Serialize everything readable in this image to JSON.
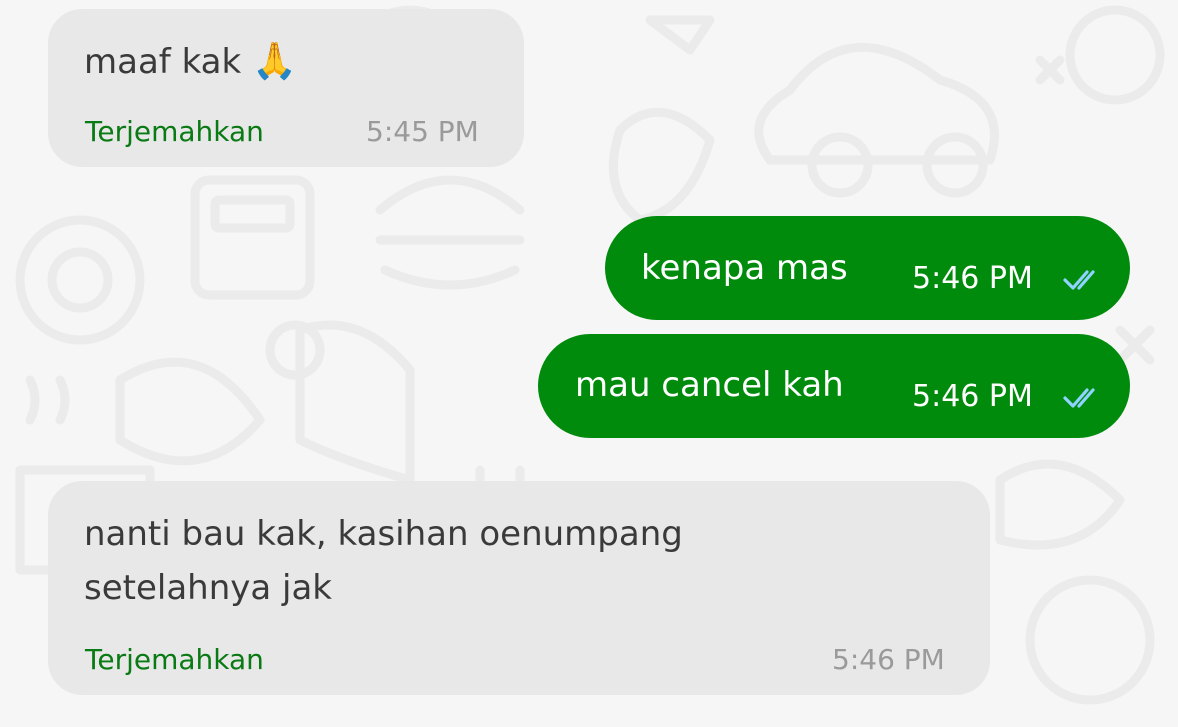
{
  "messages": [
    {
      "direction": "incoming",
      "text": "maaf kak",
      "emoji": "🙏",
      "emoji_name": "folded-hands",
      "translate_label": "Terjemahkan",
      "time": "5:45 PM"
    },
    {
      "direction": "outgoing",
      "text": "kenapa mas",
      "time": "5:46 PM",
      "status": "read-ticks"
    },
    {
      "direction": "outgoing",
      "text": "mau cancel kah",
      "time": "5:46 PM",
      "status": "read-ticks"
    },
    {
      "direction": "incoming",
      "text_line1": "nanti bau kak, kasihan oenumpang",
      "text_line2": "setelahnya jak",
      "translate_label": "Terjemahkan",
      "time": "5:46 PM"
    }
  ],
  "colors": {
    "background": "#f6f6f6",
    "incoming_bubble": "#e8e8e8",
    "outgoing_bubble": "#008b0c",
    "translate_link": "#0a7a14",
    "read_ticks": "#8fd3ff"
  }
}
